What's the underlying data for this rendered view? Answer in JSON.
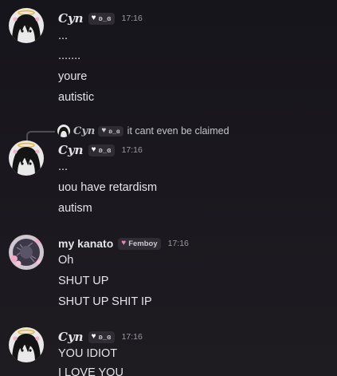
{
  "messages": [
    {
      "author": "Cyn",
      "tag_text": "ʚ_ɞ",
      "tag_icon": "white-heart-icon",
      "time": "17:16",
      "lines": [
        "...",
        ".......",
        "youre",
        "autistic"
      ]
    },
    {
      "reply": {
        "author": "Cyn",
        "tag_text": "ʚ_ɞ",
        "text": "it cant even be claimed"
      },
      "author": "Cyn",
      "tag_text": "ʚ_ɞ",
      "tag_icon": "white-heart-icon",
      "time": "17:16",
      "lines": [
        "...",
        "uou have retardism",
        "autism"
      ]
    },
    {
      "author": "my kanato",
      "tag_text": "Femboy",
      "tag_icon": "pink-heart-icon",
      "time": "17:16",
      "lines": [
        "Oh",
        "SHUT UP",
        "SHUT UP SHIT IP"
      ]
    },
    {
      "author": "Cyn",
      "tag_text": "ʚ_ɞ",
      "tag_icon": "white-heart-icon",
      "time": "17:16",
      "lines": [
        "YOU IDIOT",
        "I LOVE YOU"
      ]
    }
  ],
  "colors": {
    "background": "#18171c",
    "text": "#e3e5e8",
    "muted": "#9a9aa2",
    "tag_bg": "#2f2d33",
    "pink_heart": "#f47fbf",
    "halo": "#e8b84a"
  }
}
